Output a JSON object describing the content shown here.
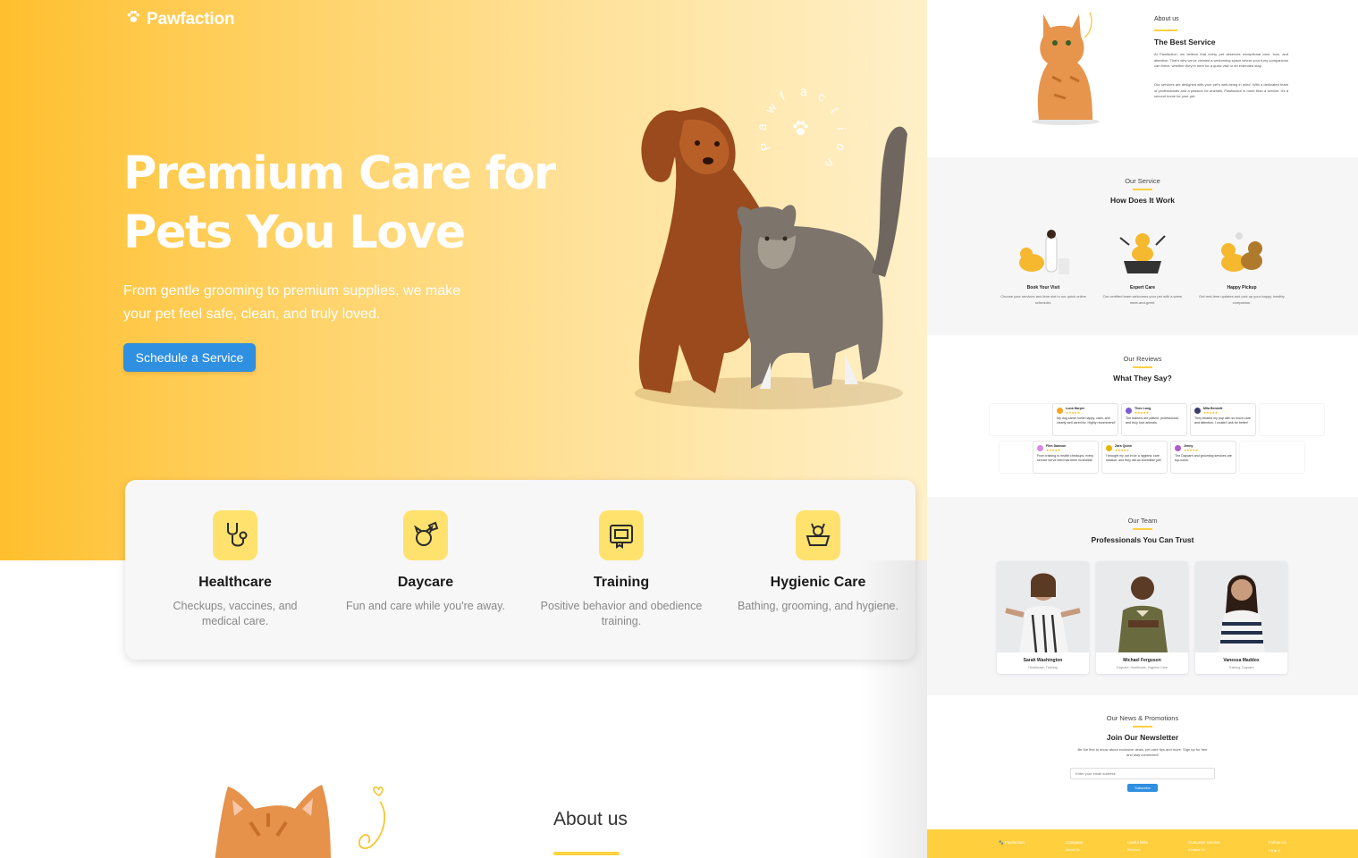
{
  "brand": {
    "name": "Pawfaction",
    "icon": "paw-icon",
    "color": "#ffffff"
  },
  "colors": {
    "accent": "#ffcf3e",
    "button": "#2f8fe0",
    "hero_start": "#ffbf2e",
    "hero_end": "#fff0c9"
  },
  "hero": {
    "title_line1": "Premium Care for",
    "title_line2": "Pets You Love",
    "subtitle": "From gentle grooming to premium supplies, we make your pet feel safe, clean, and truly loved.",
    "cta_label": "Schedule a Service",
    "circle_letters": [
      "P",
      "a",
      "w",
      "f",
      "a",
      "c",
      "t",
      "i",
      "o",
      "n"
    ]
  },
  "services": [
    {
      "icon": "stethoscope-icon",
      "title": "Healthcare",
      "desc": "Checkups, vaccines, and medical care."
    },
    {
      "icon": "dog-daycare-icon",
      "title": "Daycare",
      "desc": "Fun and care while you're away."
    },
    {
      "icon": "training-certificate-icon",
      "title": "Training",
      "desc": "Positive behavior and obedience training."
    },
    {
      "icon": "grooming-tub-icon",
      "title": "Hygienic Care",
      "desc": "Bathing, grooming, and hygiene."
    }
  ],
  "about_teaser": {
    "title": "About us"
  },
  "preview": {
    "about": {
      "kicker": "About us",
      "title": "The Best Service",
      "p1": "At Pawfaction, we believe that every pet deserves exceptional care, love, and attention. That's why we've created a welcoming space where your furry companions can thrive, whether they're here for a quick visit or an extended stay.",
      "p2": "Our services are designed with your pet's well-being in mind. With a dedicated team of professionals and a passion for animals, Pawfaction is more than a service, it's a second home for your pet."
    },
    "how": {
      "kicker": "Our Service",
      "title": "How Does It Work",
      "steps": [
        {
          "title": "Book Your Visit",
          "desc": "Choose your services and time slot in our quick online scheduler."
        },
        {
          "title": "Expert Care",
          "desc": "Our certified team welcomes your pet with a warm meet-and-greet."
        },
        {
          "title": "Happy Pickup",
          "desc": "Get real-time updates and pick up your happy, healthy companion."
        }
      ]
    },
    "reviews": {
      "kicker": "Our Reviews",
      "title": "What They Say?",
      "row1": [
        {
          "name": "Luna Harper",
          "text": "My dog came home happy, calm, and clearly well cared for. Highly recommend!",
          "color": "#f5a623"
        },
        {
          "name": "Theo Long",
          "text": "The trainers are patient, professional, and truly love animals.",
          "color": "#7b5cd6"
        },
        {
          "name": "Mila Bennett",
          "text": "They treated my pup with so much care and attention. I couldn't ask for better!",
          "color": "#3b3b6b"
        }
      ],
      "row2": [
        {
          "name": "Finn Dawson",
          "text": "From training to health checkups, every service we've tried has been incredible.",
          "color": "#d68be0"
        },
        {
          "name": "Zara Quinn",
          "text": "I brought my cat in for a hygienic care session, and they did an incredible job!",
          "color": "#e8b400"
        },
        {
          "name": "Jenny",
          "text": "The Daycare and grooming services are top-notch.",
          "color": "#b05ad0"
        }
      ]
    },
    "team": {
      "kicker": "Our Team",
      "title": "Professionals You Can Trust",
      "members": [
        {
          "name": "Sarah Washington",
          "role": "Healthcare, Training"
        },
        {
          "name": "Michael Ferguson",
          "role": "Daycare, Healthcare, Hygiene Care"
        },
        {
          "name": "Vanessa Maddox",
          "role": "Training, Daycare"
        }
      ]
    },
    "newsletter": {
      "kicker": "Our News & Promotions",
      "title": "Join Our Newsletter",
      "desc": "Be the first to know about exclusive deals, pet care tips and more. Sign up for free and stay connected!",
      "placeholder": "Enter your email address",
      "button": "Subscribe"
    },
    "footer": {
      "brand": "Pawfaction",
      "col1": "Company",
      "col1_sub": "About Us",
      "col2": "Useful links",
      "col2_sub": "Services",
      "col3": "Customer Service",
      "col3_sub": "Contact Us",
      "col4": "Follow Us"
    }
  }
}
